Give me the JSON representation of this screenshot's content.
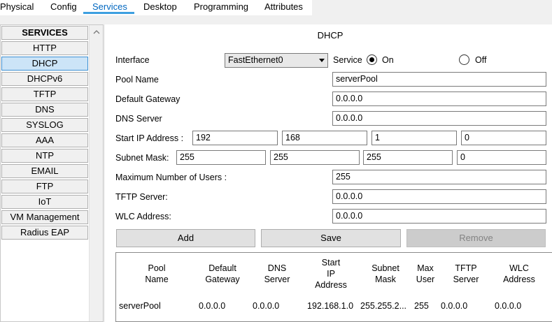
{
  "tabs": [
    "Physical",
    "Config",
    "Services",
    "Desktop",
    "Programming",
    "Attributes"
  ],
  "active_tab": "Services",
  "services": {
    "header": "SERVICES",
    "items": [
      "HTTP",
      "DHCP",
      "DHCPv6",
      "TFTP",
      "DNS",
      "SYSLOG",
      "AAA",
      "NTP",
      "EMAIL",
      "FTP",
      "IoT",
      "VM Management",
      "Radius EAP"
    ],
    "selected": "DHCP"
  },
  "dhcp": {
    "title": "DHCP",
    "interface_label": "Interface",
    "interface_value": "FastEthernet0",
    "service_label": "Service",
    "on_label": "On",
    "off_label": "Off",
    "service_state": "On",
    "pool_name_label": "Pool Name",
    "pool_name_value": "serverPool",
    "default_gateway_label": "Default Gateway",
    "default_gateway_value": "0.0.0.0",
    "dns_server_label": "DNS Server",
    "dns_server_value": "0.0.0.0",
    "start_ip_label": "Start IP Address :",
    "start_ip": [
      "192",
      "168",
      "1",
      "0"
    ],
    "subnet_label": "Subnet Mask:",
    "subnet": [
      "255",
      "255",
      "255",
      "0"
    ],
    "max_users_label": "Maximum Number of Users :",
    "max_users_value": "255",
    "tftp_label": "TFTP Server:",
    "tftp_value": "0.0.0.0",
    "wlc_label": "WLC Address:",
    "wlc_value": "0.0.0.0",
    "buttons": {
      "add": "Add",
      "save": "Save",
      "remove": "Remove"
    },
    "table": {
      "headers": [
        "Pool\nName",
        "Default\nGateway",
        "DNS\nServer",
        "Start\nIP\nAddress",
        "Subnet\nMask",
        "Max\nUser",
        "TFTP\nServer",
        "WLC\nAddress"
      ],
      "rows": [
        [
          "serverPool",
          "0.0.0.0",
          "0.0.0.0",
          "192.168.1.0",
          "255.255.2...",
          "255",
          "0.0.0.0",
          "0.0.0.0"
        ]
      ]
    }
  },
  "colors": {
    "accent": "#0067c0",
    "selection": "#cce4f7"
  }
}
